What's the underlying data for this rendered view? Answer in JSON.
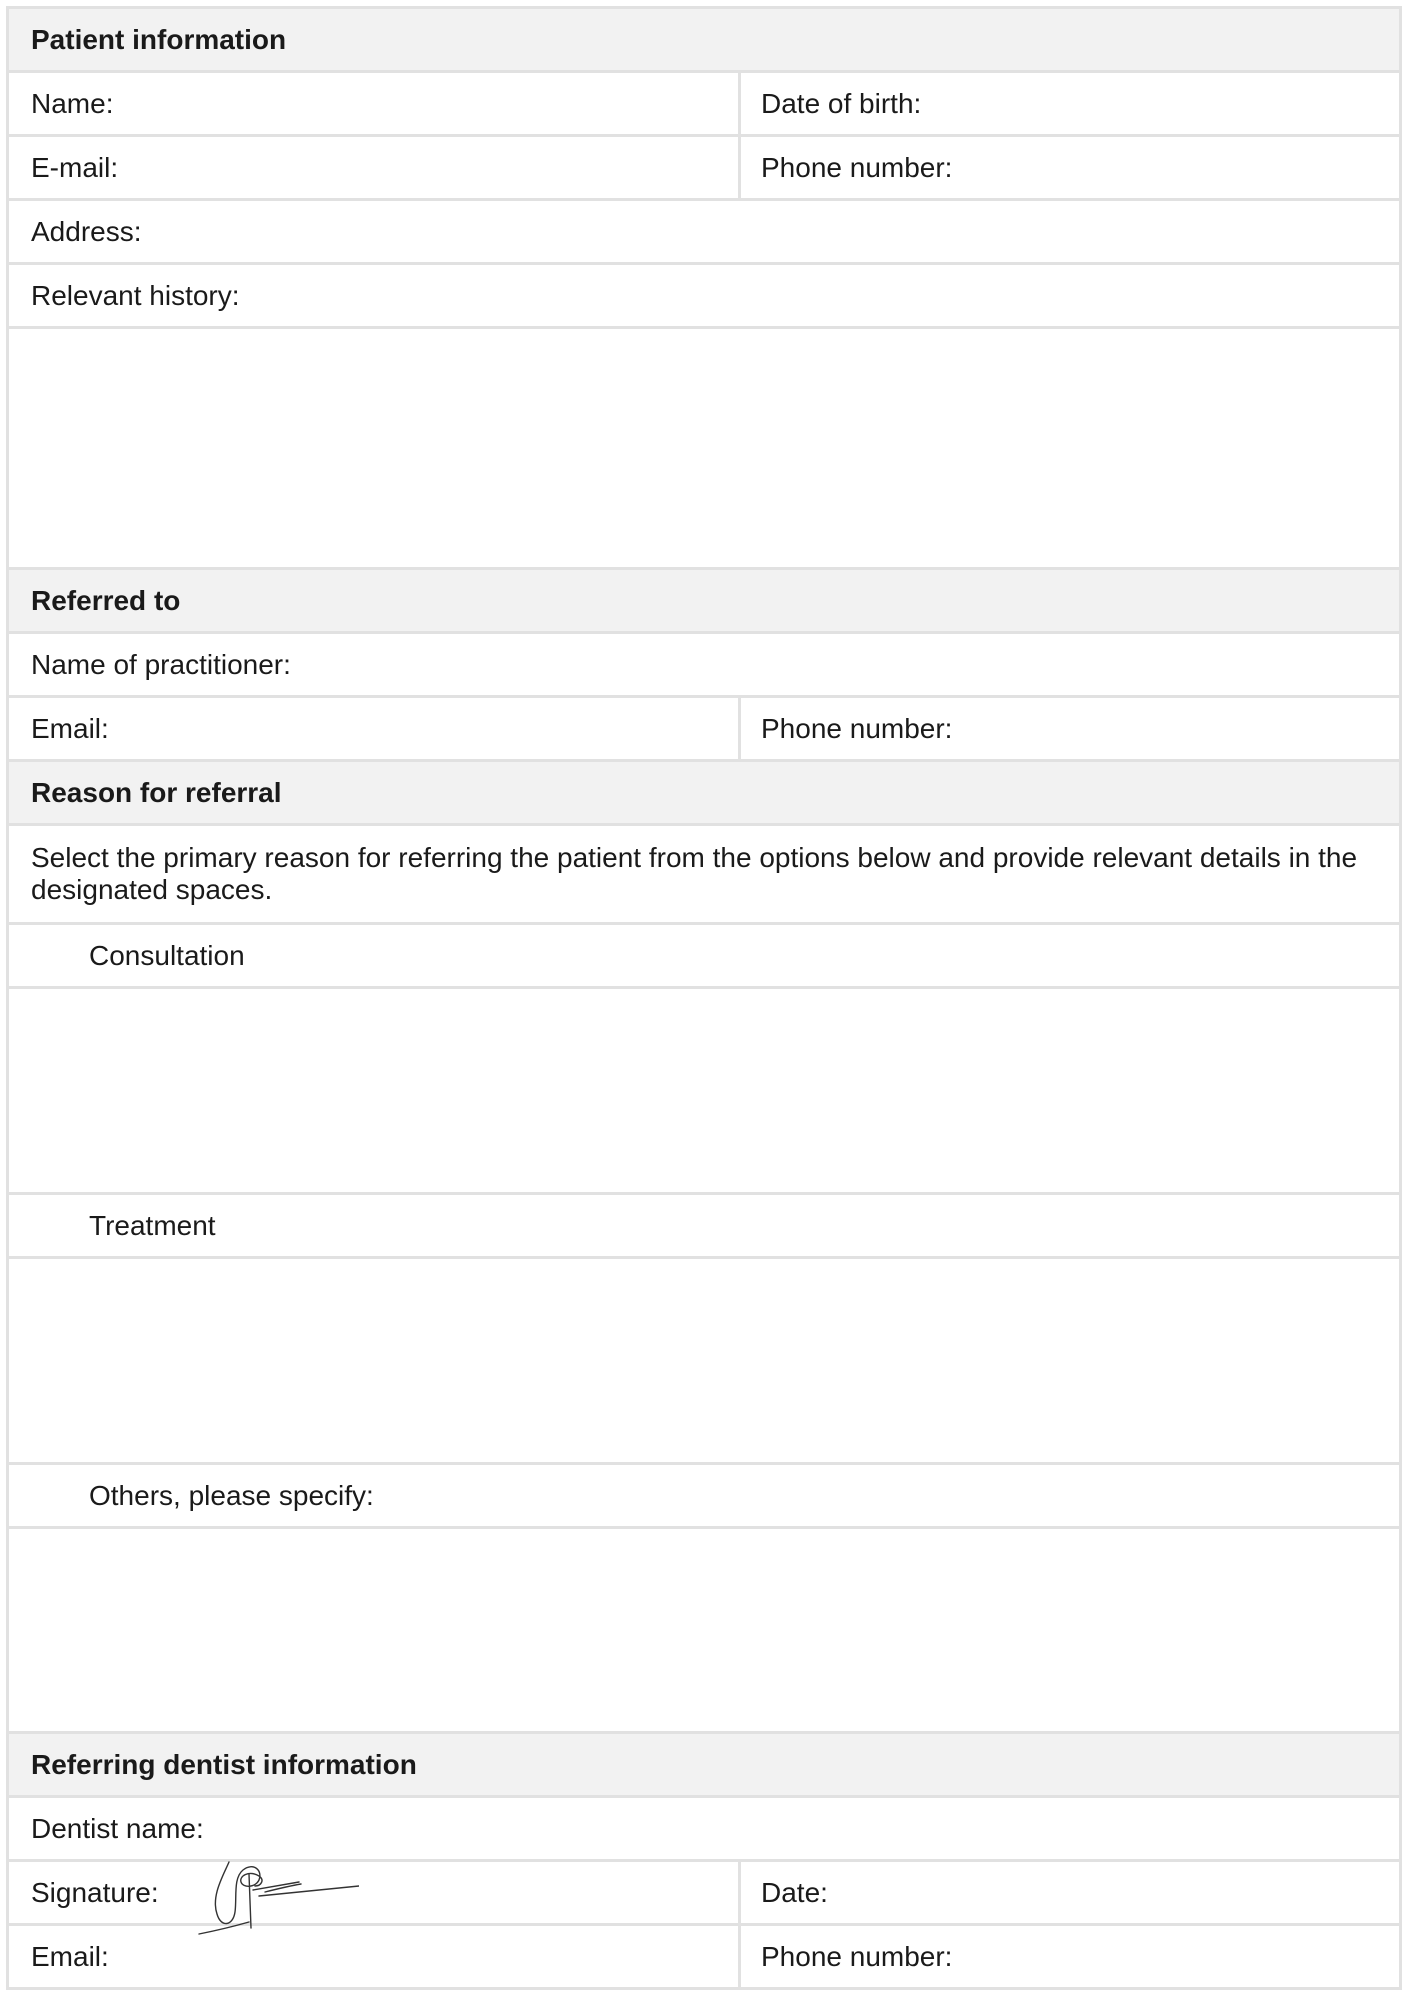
{
  "patient": {
    "heading": "Patient information",
    "name_label": "Name:",
    "dob_label": "Date of birth:",
    "email_label": "E-mail:",
    "phone_label": "Phone number:",
    "address_label": "Address:",
    "history_label": "Relevant history:"
  },
  "referred_to": {
    "heading": "Referred to",
    "practitioner_label": "Name of practitioner:",
    "email_label": "Email:",
    "phone_label": "Phone number:"
  },
  "reason": {
    "heading": "Reason for referral",
    "instructions": "Select the primary reason for referring the patient from the options below and provide relevant details in the designated spaces.",
    "options": [
      "Consultation",
      "Treatment",
      "Others, please specify:"
    ]
  },
  "referring_dentist": {
    "heading": "Referring dentist information",
    "name_label": "Dentist name:",
    "signature_label": "Signature:",
    "date_label": "Date:",
    "email_label": "Email:",
    "phone_label": "Phone number:"
  }
}
